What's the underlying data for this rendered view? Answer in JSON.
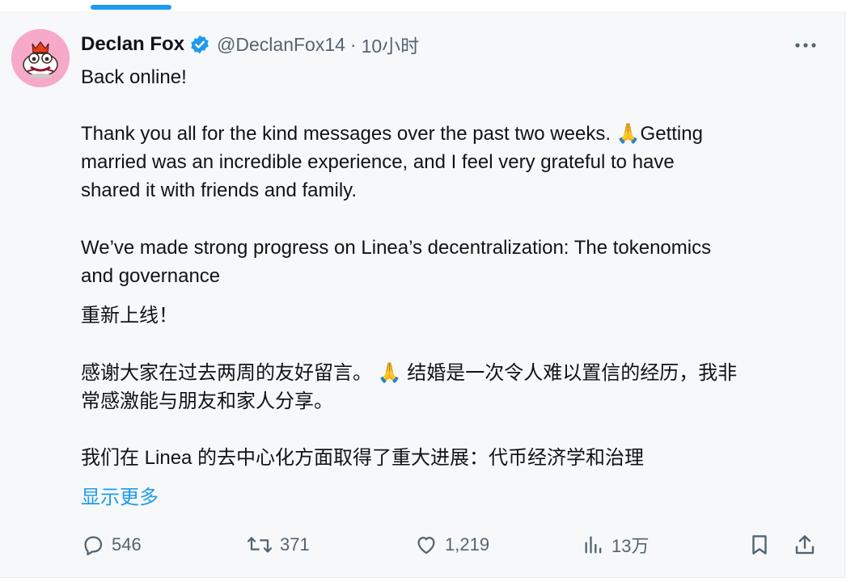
{
  "tweet": {
    "display_name": "Declan Fox",
    "handle": "@DeclanFox14",
    "separator": "·",
    "timestamp": "10小时",
    "lines_en": [
      "Back online!",
      "Thank you all for the kind messages over the past two weeks. 🙏Getting",
      "married was an incredible experience, and I feel very grateful to have",
      "shared it with friends and family.",
      "We’ve made strong progress on Linea’s decentralization: The tokenomics",
      "and governance"
    ],
    "lines_zh": [
      "重新上线！",
      "感谢大家在过去两周的友好留言。 🙏 结婚是一次令人难以置信的经历，我非",
      "常感激能与朋友和家人分享。",
      "我们在 Linea 的去中心化方面取得了重大进展：代币经济学和治理"
    ],
    "show_more_label": "显示更多"
  },
  "actions": {
    "reply_count": "546",
    "repost_count": "371",
    "like_count": "1,219",
    "views_count": "13万"
  },
  "icons": {
    "verified": "verified-badge-icon",
    "more": "more-horizontal-icon",
    "reply": "reply-icon",
    "repost": "repost-icon",
    "like": "heart-icon",
    "views": "views-chart-icon",
    "bookmark": "bookmark-icon",
    "share": "share-icon"
  },
  "colors": {
    "accent": "#1d9bf0",
    "text_primary": "#0f1419",
    "text_secondary": "#536471",
    "card_background": "#f7f8f9",
    "avatar_background": "#f6a9c8"
  }
}
